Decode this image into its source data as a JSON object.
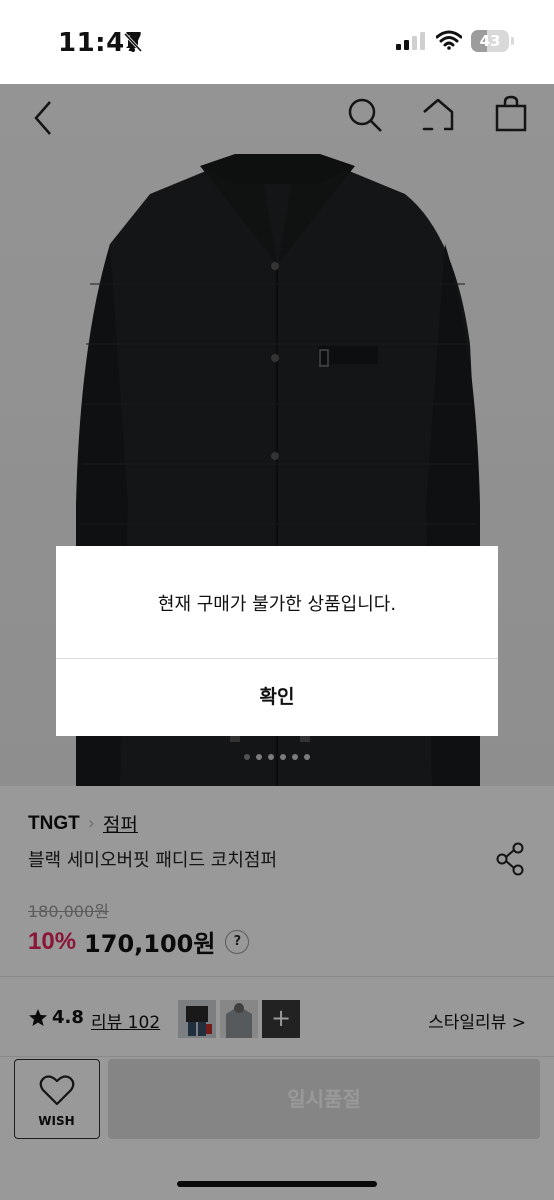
{
  "status_bar": {
    "time": "11:47",
    "battery_level": "43",
    "battery_fraction": 0.43
  },
  "nav": {
    "icons": [
      "back-icon",
      "search-icon",
      "home-icon",
      "shopping-bag-icon"
    ]
  },
  "product": {
    "brand": "TNGT",
    "category": "점퍼",
    "name": "블랙 세미오버핏 패디드 코치점퍼",
    "original_price": "180,000원",
    "discount": "10%",
    "sale_price": "170,100원",
    "help_label": "?",
    "rating_value": "4.8",
    "review_label": "리뷰 102",
    "thumbnail_more": "+",
    "style_review_label": "스타일리뷰 >",
    "image_dots": 6,
    "active_dot": 0
  },
  "bottom": {
    "wish_label": "WISH",
    "soldout_label": "일시품절"
  },
  "dialog": {
    "message": "현재 구매가 불가한 상품입니다.",
    "confirm_label": "확인"
  },
  "colors": {
    "discount": "#e8235a",
    "overlay": "rgba(0,0,0,0.4)",
    "soldout_bg": "#dedede"
  }
}
